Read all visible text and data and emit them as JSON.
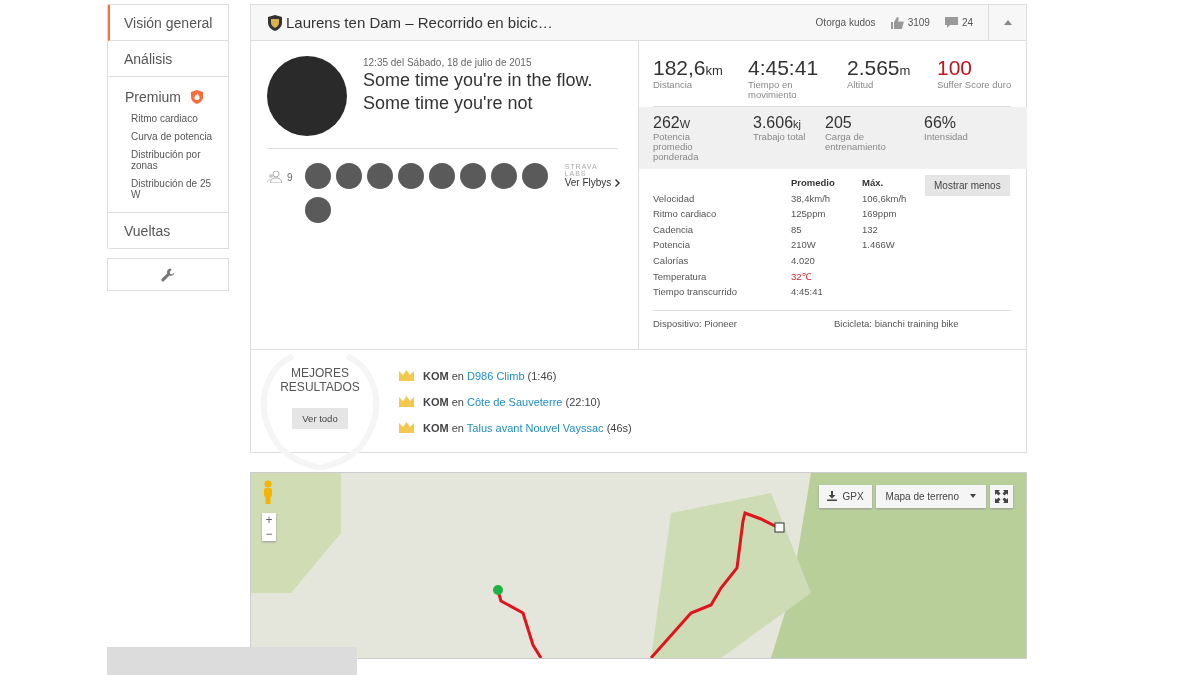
{
  "sidebar": {
    "items": [
      {
        "label": "Visión general",
        "selected": true
      },
      {
        "label": "Análisis",
        "selected": false
      },
      {
        "label": "Premium",
        "selected": false,
        "children": [
          {
            "label": "Ritmo cardiaco",
            "selected": false
          },
          {
            "label": "Curva de potencia",
            "selected": false
          },
          {
            "label": "Distribución por zonas",
            "selected": false
          },
          {
            "label": "Distribución de 25 W",
            "selected": false
          }
        ]
      },
      {
        "label": "Vueltas",
        "selected": false
      }
    ]
  },
  "header": {
    "title": "Laurens ten Dam – Recorrido en bicic…",
    "kudos_label": "Otorga kudos",
    "kudos_count": "3109",
    "comments_count": "24"
  },
  "activity": {
    "timestamp": "12:35 del Sábado, 18 de julio de 2015",
    "title": "Some time you're in the flow. Some time you're not",
    "group_count": "9",
    "avatars": [
      {
        "kind": "photo"
      },
      {
        "kind": "photo"
      },
      {
        "kind": "photo"
      },
      {
        "kind": "photo"
      },
      {
        "kind": "photo"
      },
      {
        "kind": "photo"
      },
      {
        "kind": "photo"
      },
      {
        "kind": "photo"
      },
      {
        "kind": "photo"
      }
    ],
    "labs_label": "STRAVA LABS",
    "flybys_link": "Ver Flybys"
  },
  "primary_stats": [
    {
      "value": "182,6",
      "unit": "km",
      "label": "Distancia",
      "kind": "normal"
    },
    {
      "value": "4:45:41",
      "label": "Tiempo en movimiento",
      "kind": "normal"
    },
    {
      "value": "2.565",
      "unit": "m",
      "label": "Altitud",
      "kind": "normal"
    },
    {
      "value": "100",
      "label": "Suffer Score duro",
      "kind": "suffer"
    }
  ],
  "secondary_stats": [
    {
      "value": "262",
      "unit": "W",
      "label": "Potencia promedio ponderada"
    },
    {
      "value": "3.606",
      "unit": "kj",
      "label": "Trabajo total"
    },
    {
      "value": "205",
      "label": "Carga de entrenamiento"
    },
    {
      "value": "66%",
      "label": "Intensidad"
    }
  ],
  "details": {
    "columns": [
      "Promedio",
      "Máx."
    ],
    "toggle_button": "Mostrar menos",
    "rows": [
      {
        "label": "Velocidad",
        "average": "38,4km/h",
        "max": "106,6km/h",
        "alert": false
      },
      {
        "label": "Ritmo cardiaco",
        "average": "125ppm",
        "max": "169ppm",
        "alert": false
      },
      {
        "label": "Cadencia",
        "average": "85",
        "max": "132",
        "alert": false
      },
      {
        "label": "Potencia",
        "average": "210W",
        "max": "1.466W",
        "alert": false
      },
      {
        "label": "Calorías",
        "average": "4.020",
        "alert": false
      },
      {
        "label": "Temperatura",
        "average": "32℃",
        "alert": true
      },
      {
        "label": "Tiempo transcurrido",
        "average": "4:45:41",
        "alert": false
      }
    ],
    "device": "Dispositivo: Pioneer",
    "bike": "Bicicleta: bianchi training bike"
  },
  "achievements": {
    "title": "MEJORES RESULTADOS",
    "button": "Ver todo",
    "items": [
      {
        "badge": "KOM",
        "connector": "en",
        "segment": "D986 Climb",
        "time": "(1:46)"
      },
      {
        "badge": "KOM",
        "connector": "en",
        "segment": "Côte de Sauveterre",
        "time": "(22:10)"
      },
      {
        "badge": "KOM",
        "connector": "en",
        "segment": "Talus avant Nouvel Vayssac",
        "time": "(46s)"
      }
    ]
  },
  "map": {
    "zoom_in": "+",
    "zoom_out": "−",
    "gpx_button": "GPX",
    "map_type": "Mapa de terreno"
  }
}
